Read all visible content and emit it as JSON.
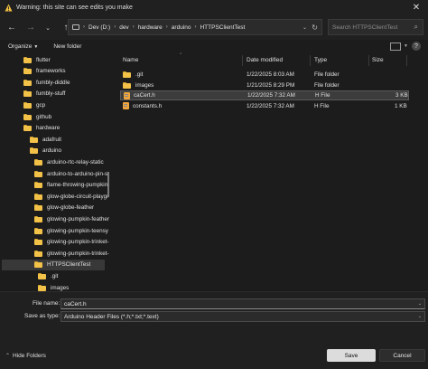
{
  "window": {
    "title": "Warning: this site can see edits you make"
  },
  "address": {
    "crumbs": [
      "Dev (D:)",
      "dev",
      "hardware",
      "arduino",
      "HTTPSClientTest"
    ],
    "search_placeholder": "Search HTTPSClientTest"
  },
  "toolbar": {
    "organize_label": "Organize",
    "new_folder_label": "New folder"
  },
  "nav": {
    "items": [
      {
        "label": "flutter",
        "indent": 1
      },
      {
        "label": "frameworks",
        "indent": 1
      },
      {
        "label": "fumbly-diddle",
        "indent": 1
      },
      {
        "label": "fumbly-stuff",
        "indent": 1
      },
      {
        "label": "gcp",
        "indent": 1
      },
      {
        "label": "github",
        "indent": 1
      },
      {
        "label": "hardware",
        "indent": 1
      },
      {
        "label": "adafruit",
        "indent": 2
      },
      {
        "label": "arduino",
        "indent": 2
      },
      {
        "label": "arduino-rtc-relay-static",
        "indent": 3
      },
      {
        "label": "arduino-to-arduino-pin-s",
        "indent": 3
      },
      {
        "label": "flame-throwing-pumpkin-",
        "indent": 3
      },
      {
        "label": "glow-globe-circuit-playgr",
        "indent": 3
      },
      {
        "label": "glow-globe-feather",
        "indent": 3
      },
      {
        "label": "glowing-pumpkin-feather",
        "indent": 3
      },
      {
        "label": "glowing-pumpkin-teensy",
        "indent": 3
      },
      {
        "label": "glowing-pumpkin-trinket-",
        "indent": 3
      },
      {
        "label": "glowing-pumpkin-trinket-",
        "indent": 3
      },
      {
        "label": "HTTPSClientTest",
        "indent": 3,
        "selected": true
      },
      {
        "label": ".git",
        "indent": 4
      },
      {
        "label": "images",
        "indent": 4
      }
    ]
  },
  "columns": {
    "name": "Name",
    "date": "Date modified",
    "type": "Type",
    "size": "Size"
  },
  "files": [
    {
      "name": ".git",
      "date": "1/22/2025 8:03 AM",
      "type": "File folder",
      "size": "",
      "icon": "folder-icon"
    },
    {
      "name": "images",
      "date": "1/21/2025 8:29 PM",
      "type": "File folder",
      "size": "",
      "icon": "folder-icon"
    },
    {
      "name": "caCert.h",
      "date": "1/22/2025 7:32 AM",
      "type": "H File",
      "size": "3 KB",
      "icon": "h-file-icon",
      "selected": true
    },
    {
      "name": "constants.h",
      "date": "1/22/2025 7:32 AM",
      "type": "H File",
      "size": "1 KB",
      "icon": "h-file-icon"
    }
  ],
  "footer": {
    "file_name_label": "File name:",
    "file_name_value": "caCert.h",
    "save_as_type_label": "Save as type:",
    "save_as_type_value": "Arduino Header Files (*.h;*.txt;*.text)",
    "hide_folders_label": "Hide Folders",
    "save_label": "Save",
    "cancel_label": "Cancel"
  }
}
